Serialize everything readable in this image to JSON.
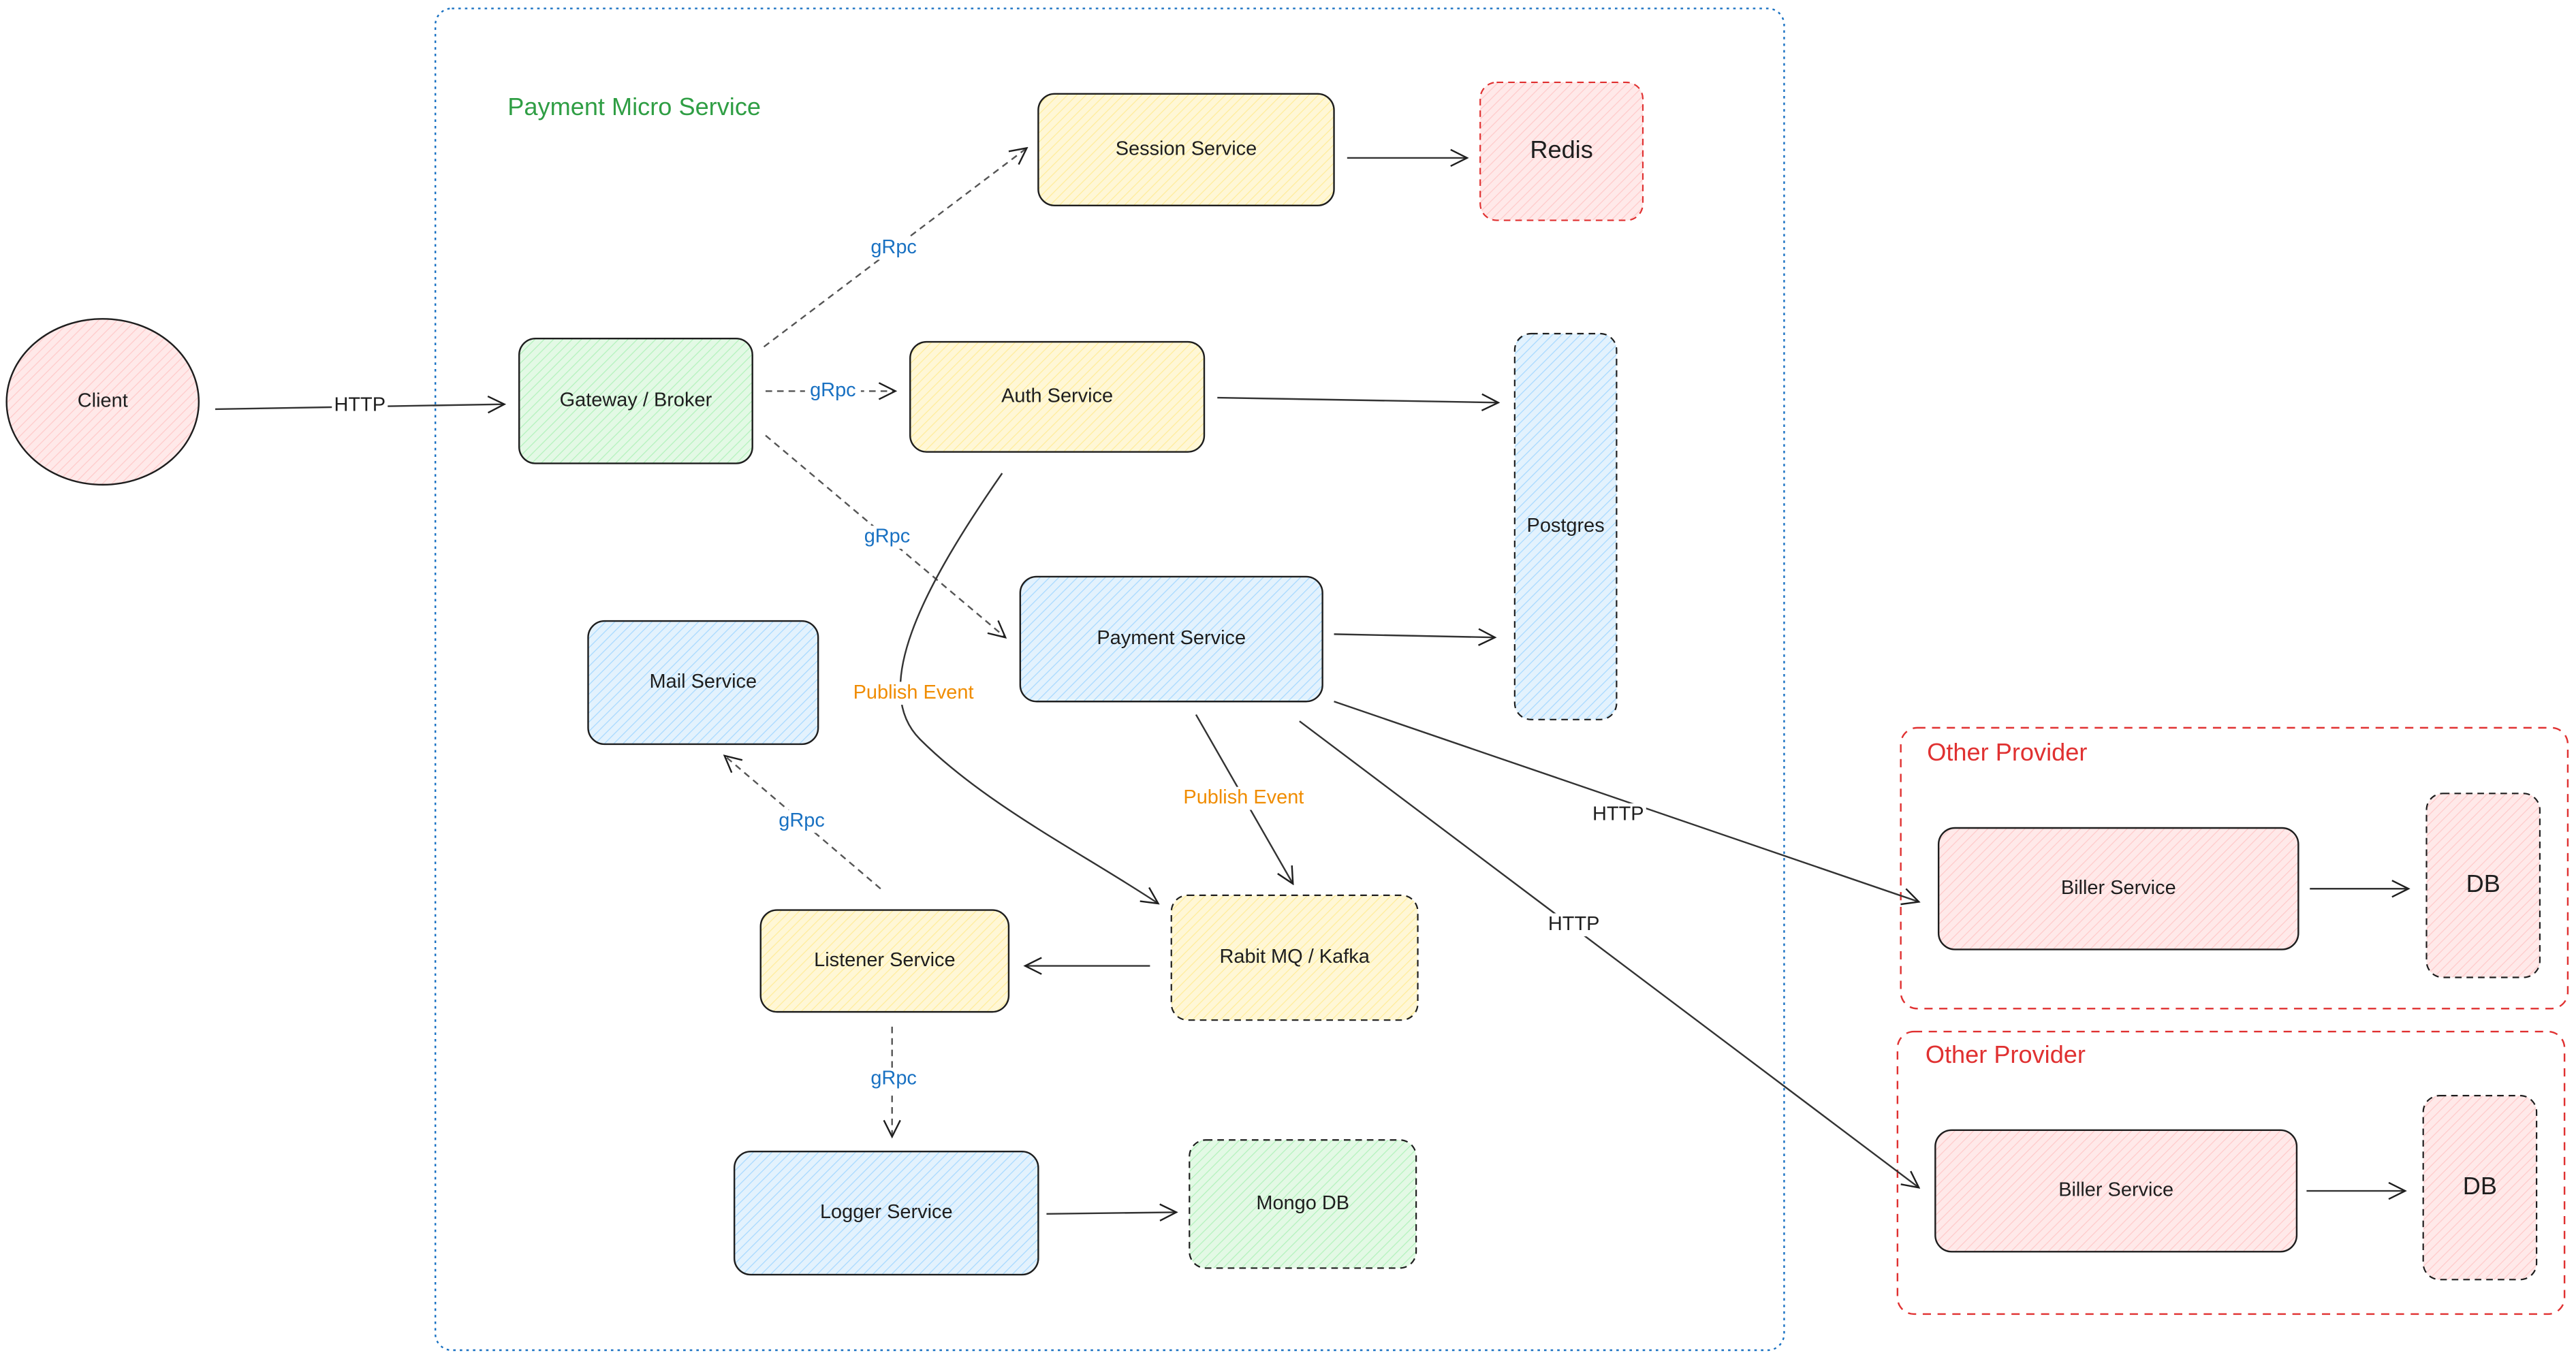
{
  "colors": {
    "container_border": "#1971c2",
    "group_border": "#e03131",
    "title_green": "#2f9e44",
    "title_red": "#e03131",
    "grpc_label": "#1971c2",
    "event_label": "#f08c00",
    "pink_fill": "#ffc9c9",
    "green_fill": "#b2f2bb",
    "yellow_fill": "#ffec99",
    "blue_fill": "#a5d8ff"
  },
  "groups": {
    "payment": {
      "title": "Payment Micro Service"
    },
    "provider1": {
      "title": "Other Provider"
    },
    "provider2": {
      "title": "Other Provider"
    }
  },
  "nodes": {
    "client": "Client",
    "gateway": "Gateway / Broker",
    "session": "Session Service",
    "redis": "Redis",
    "auth": "Auth Service",
    "postgres": "Postgres",
    "payment": "Payment Service",
    "mail": "Mail Service",
    "listener": "Listener Service",
    "rabbit": "Rabit MQ / Kafka",
    "logger": "Logger Service",
    "mongo": "Mongo DB",
    "biller1": "Biller Service",
    "db1": "DB",
    "biller2": "Biller Service",
    "db2": "DB"
  },
  "edges": {
    "client_gateway": "HTTP",
    "gateway_session": "gRpc",
    "gateway_auth": "gRpc",
    "gateway_payment": "gRpc",
    "auth_rabbit": "Publish Event",
    "payment_rabbit": "Publish Event",
    "payment_biller1": "HTTP",
    "payment_biller2": "HTTP",
    "listener_mail": "gRpc",
    "listener_logger": "gRpc"
  }
}
